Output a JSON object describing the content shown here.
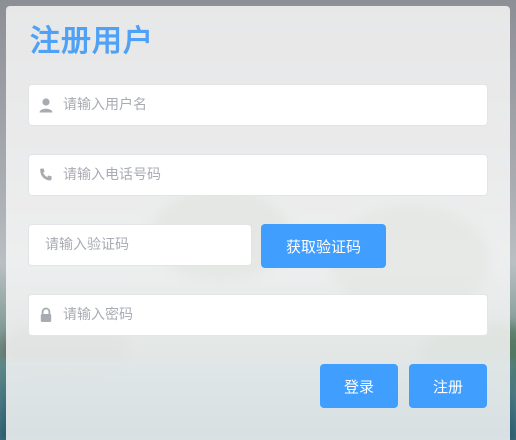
{
  "form": {
    "title": "注册用户",
    "username": {
      "placeholder": "请输入用户名",
      "icon": "user-icon"
    },
    "phone": {
      "placeholder": "请输入电话号码",
      "icon": "phone-icon"
    },
    "code": {
      "placeholder": "请输入验证码"
    },
    "password": {
      "placeholder": "请输入密码",
      "icon": "lock-icon"
    },
    "get_code_label": "获取验证码",
    "login_label": "登录",
    "register_label": "注册"
  },
  "colors": {
    "accent": "#409eff",
    "title": "#4ea1f5",
    "icon": "#a8abb2"
  }
}
